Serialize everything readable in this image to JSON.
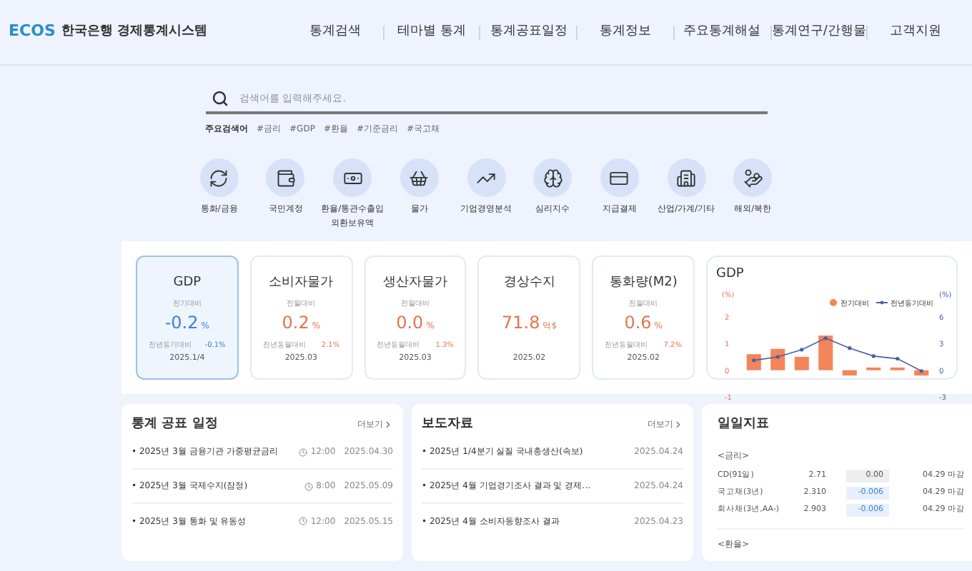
{
  "header": {
    "logo": "ECOS",
    "site_name": "한국은행 경제통계시스템",
    "nav": [
      "통계검색",
      "테마별 통계",
      "통계공표일정",
      "통계정보",
      "주요통계해설",
      "통계연구/간행물",
      "고객지원"
    ]
  },
  "search": {
    "placeholder": "검색어를 입력해주세요.",
    "keywords_label": "주요검색어",
    "keywords": [
      "#금리",
      "#GDP",
      "#환율",
      "#기준금리",
      "#국고채"
    ]
  },
  "categories": [
    {
      "label": "통화/금융"
    },
    {
      "label": "국민계정"
    },
    {
      "label": "환율/통관수출입\n외환보유액"
    },
    {
      "label": "물가"
    },
    {
      "label": "기업경영분석"
    },
    {
      "label": "심리지수"
    },
    {
      "label": "지급결제"
    },
    {
      "label": "산업/가계/기타"
    },
    {
      "label": "해외/북한"
    }
  ],
  "indicators": [
    {
      "title": "GDP",
      "selected": true,
      "compare_label": "전기대비",
      "value": "-0.2",
      "unit": "%",
      "color": "#3b82d6",
      "yoy_label": "전년동기대비",
      "yoy": "-0.1%",
      "date": "2025.1/4"
    },
    {
      "title": "소비자물가",
      "selected": false,
      "compare_label": "전월대비",
      "value": "0.2",
      "unit": "%",
      "color": "#e2744f",
      "yoy_label": "전년동월대비",
      "yoy": "2.1%",
      "date": "2025.03"
    },
    {
      "title": "생산자물가",
      "selected": false,
      "compare_label": "전월대비",
      "value": "0.0",
      "unit": "%",
      "color": "#e2744f",
      "yoy_label": "전년동월대비",
      "yoy": "1.3%",
      "date": "2025.03"
    },
    {
      "title": "경상수지",
      "selected": false,
      "value": "71.8",
      "unit": "억$",
      "color": "#e2744f",
      "date": "2025.02"
    },
    {
      "title": "통화량(M2)",
      "selected": false,
      "compare_label": "전월대비",
      "value": "0.6",
      "unit": "%",
      "color": "#e2744f",
      "yoy_label": "전년동월대비",
      "yoy": "7.2%",
      "date": "2025.02"
    }
  ],
  "gdp_chart": {
    "title": "GDP",
    "chart_data": {
      "type": "bar",
      "ylabel": "(%)",
      "ylim": [
        -1,
        2
      ],
      "yticks": [
        2,
        1,
        0,
        -1
      ],
      "series": [
        {
          "name": "전기대비",
          "color": "#f4845a",
          "type": "bar",
          "values": [
            0.6,
            0.8,
            0.5,
            1.3,
            -0.2,
            0.1,
            0.1,
            -0.2
          ]
        },
        {
          "name": "전년동기대비",
          "color": "#4a5fa8",
          "type": "line",
          "values": [
            0.37,
            0.5,
            0.77,
            1.2,
            0.83,
            0.53,
            0.43,
            -0.03
          ]
        }
      ],
      "legend": "top-right",
      "annotations": [
        "(%)",
        "6",
        "3",
        "0",
        "-3"
      ]
    }
  },
  "schedule": {
    "title": "통계 공표 일정",
    "more": "더보기",
    "items": [
      {
        "title": "• 2025년 3월 금융기관 가중평균금리",
        "time": "12:00",
        "date": "2025.04.30"
      },
      {
        "title": "• 2025년 3월 국제수지(잠정)",
        "time": "8:00",
        "date": "2025.05.09"
      },
      {
        "title": "• 2025년 3월 통화 및 유동성",
        "time": "12:00",
        "date": "2025.05.15"
      }
    ]
  },
  "press": {
    "title": "보도자료",
    "more": "더보기",
    "items": [
      {
        "title": "• 2025년 1/4분기 실질 국내총생산(속보)",
        "date": "2025.04.24"
      },
      {
        "title": "• 2025년 4월 기업경기조사 결과 및 경제…",
        "date": "2025.04.24"
      },
      {
        "title": "• 2025년 4월 소비자동향조사 결과",
        "date": "2025.04.23"
      }
    ]
  },
  "daily": {
    "title": "일일지표",
    "groups": [
      {
        "label": "<금리>",
        "rows": [
          {
            "name": "CD(91일)",
            "value": "2.71",
            "change": "0.00",
            "color": "#555555",
            "date": "04.29 마감"
          },
          {
            "name": "국고채(3년)",
            "value": "2.310",
            "change": "-0.006",
            "color": "#3b82d6",
            "date": "04.29 마감"
          },
          {
            "name": "회사채(3년,AA-)",
            "value": "2.903",
            "change": "-0.006",
            "color": "#3b82d6",
            "date": "04.29 마감"
          }
        ]
      },
      {
        "label": "<환율>"
      }
    ]
  }
}
